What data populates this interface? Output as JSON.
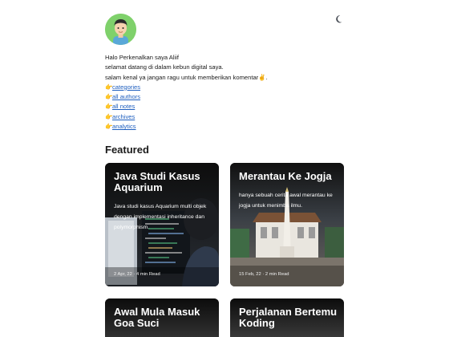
{
  "intro": {
    "greeting": "Halo Perkenalkan saya Aliif",
    "welcome": "selamat datang di dalam kebun digital saya.",
    "comment": "salam kenal ya jangan ragu untuk memberikan komentar✌️.",
    "links": [
      "categories",
      "all authors",
      "all notes",
      "archives",
      "analytics"
    ],
    "link_icon": "👉"
  },
  "section": {
    "featured_title": "Featured"
  },
  "cards": [
    {
      "title": "Java Studi Kasus Aquarium",
      "description": "Java studi kasus Aquarium multi objek dengan implementasi inheritance dan polymorphism.",
      "meta": "2 Apr, 22 · 4 min Read"
    },
    {
      "title": "Merantau Ke Jogja",
      "description": "hanya sebuah cerita awal merantau ke jogja untuk menimba ilmu.",
      "meta": "15 Feb, 22 · 2 min Read"
    },
    {
      "title": "Awal Mula Masuk Goa Suci"
    },
    {
      "title": "Perjalanan Bertemu Koding"
    }
  ],
  "icons": {
    "theme_toggle": "moon-icon",
    "link_pointer": "pointing-hand-icon"
  },
  "colors": {
    "link": "#1f5fbf",
    "avatar_bg": "#7fd16b",
    "card_bg": "#1b1b1b"
  }
}
